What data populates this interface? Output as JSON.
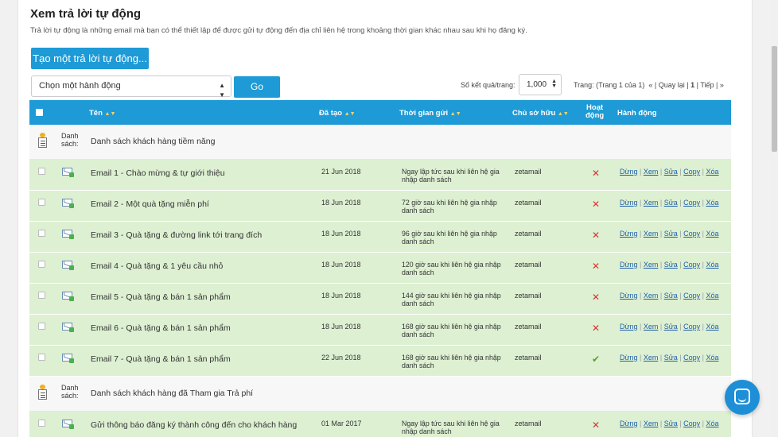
{
  "header": {
    "title": "Xem trả lời tự động",
    "intro": "Trả lời tự động là những email mà bạn có thể thiết lập để được gửi tự động đến địa chỉ liên hệ trong khoảng thời gian khác nhau sau khi họ đăng ký."
  },
  "toolbar": {
    "create_label": "Tạo một trả lời tự động...",
    "action_select": "Chọn một hành động",
    "go_label": "Go",
    "perpage_label": "Số kết quả/trang:",
    "perpage_value": "1,000",
    "pager_text": "Trang: (Trang 1 của 1)",
    "pager_back": "« | Quay lại |",
    "pager_current": "1",
    "pager_next": "| Tiếp | »"
  },
  "table": {
    "columns": {
      "name": "Tên",
      "created": "Đã tạo",
      "send_time": "Thời gian gửi",
      "owner": "Chủ sở hữu",
      "active_line1": "Hoạt",
      "active_line2": "động",
      "actions": "Hành động"
    },
    "sort_glyph": "▲▼",
    "action_labels": {
      "stop": "Dừng",
      "view": "Xem",
      "edit": "Sửa",
      "copy": "Copy",
      "delete": "Xóa"
    },
    "groups": [
      {
        "label_line1": "Danh",
        "label_line2": "sách:",
        "name": "Danh sách khách hàng tiềm năng",
        "rows": [
          {
            "name": "Email 1 - Chào mừng & tự giới thiệu",
            "created": "21 Jun 2018",
            "send_time": "Ngay lập tức sau khi liên hệ gia nhập danh sách",
            "owner": "zetamail",
            "active": "✕"
          },
          {
            "name": "Email 2 - Một quà tặng miễn phí",
            "created": "18 Jun 2018",
            "send_time": "72 giờ sau khi liên hệ gia nhập danh sách",
            "owner": "zetamail",
            "active": "✕"
          },
          {
            "name": "Email 3 - Quà tặng & đường link tới trang đích",
            "created": "18 Jun 2018",
            "send_time": "96 giờ sau khi liên hệ gia nhập danh sách",
            "owner": "zetamail",
            "active": "✕"
          },
          {
            "name": "Email 4 - Quà tặng & 1 yêu cầu nhỏ",
            "created": "18 Jun 2018",
            "send_time": "120 giờ sau khi liên hệ gia nhập danh sách",
            "owner": "zetamail",
            "active": "✕"
          },
          {
            "name": "Email 5 - Quà tặng & bán 1 sản phẩm",
            "created": "18 Jun 2018",
            "send_time": "144 giờ sau khi liên hệ gia nhập danh sách",
            "owner": "zetamail",
            "active": "✕"
          },
          {
            "name": "Email 6 - Quà tặng & bán 1 sản phẩm",
            "created": "18 Jun 2018",
            "send_time": "168 giờ sau khi liên hệ gia nhập danh sách",
            "owner": "zetamail",
            "active": "✕"
          },
          {
            "name": "Email 7 - Quà tặng & bán 1 sản phẩm",
            "created": "22 Jun 2018",
            "send_time": "168 giờ sau khi liên hệ gia nhập danh sách",
            "owner": "zetamail",
            "active": "✔"
          }
        ]
      },
      {
        "label_line1": "Danh",
        "label_line2": "sách:",
        "name": "Danh sách khách hàng đã Tham gia Trả phí",
        "rows": [
          {
            "name": "Gửi thông báo đăng ký thành công đến cho khách hàng",
            "created": "01 Mar 2017",
            "send_time": "Ngay lập tức sau khi liên hệ gia nhập danh sách",
            "owner": "zetamail",
            "active": "✕"
          }
        ]
      }
    ]
  },
  "colors": {
    "accent": "#1e9ad6",
    "row_bg": "#ddf0d2",
    "inactive": "#e03030",
    "active": "#5a9e2f"
  }
}
